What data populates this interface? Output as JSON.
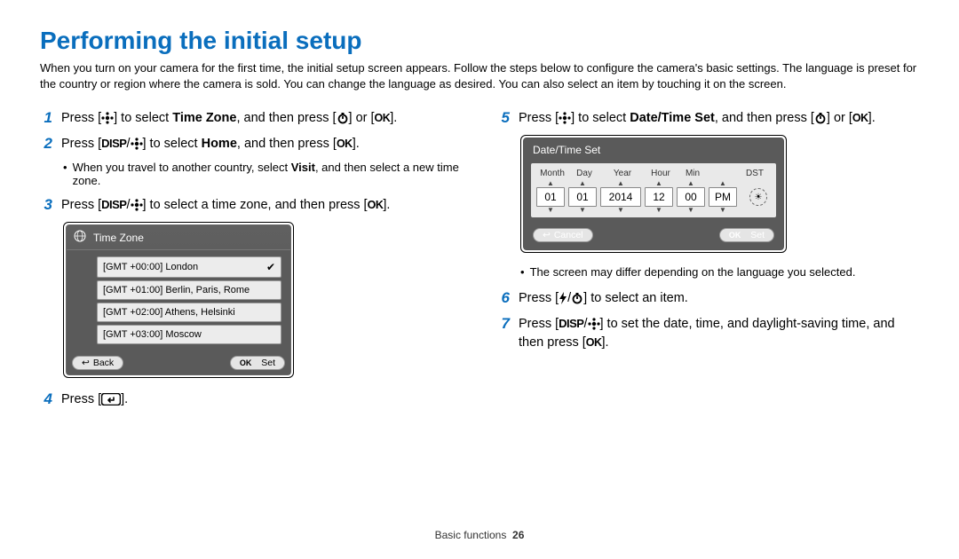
{
  "title": "Performing the initial setup",
  "intro": "When you turn on your camera for the first time, the initial setup screen appears. Follow the steps below to configure the camera's basic settings. The language is preset for the country or region where the camera is sold. You can change the language as desired. You can also select an item by touching it on the screen.",
  "steps": {
    "s1_a": "Press [",
    "s1_b": "] to select ",
    "s1_bold": "Time Zone",
    "s1_c": ", and then press [",
    "s1_d": "] or [",
    "s1_e": "].",
    "s2_a": "Press [",
    "s2_b": "] to select ",
    "s2_bold": "Home",
    "s2_c": ", and then press [",
    "s2_d": "].",
    "s2_sub": "When you travel to another country, select ",
    "s2_sub_b": "Visit",
    "s2_sub_c": ", and then select a new time zone.",
    "s3_a": "Press [",
    "s3_b": "] to select a time zone, and then press [",
    "s3_c": "].",
    "s4_a": "Press [",
    "s4_b": "].",
    "s5_a": "Press [",
    "s5_b": "] to select ",
    "s5_bold": "Date/Time Set",
    "s5_c": ", and then press [",
    "s5_d": "] or [",
    "s5_e": "].",
    "s5_sub": "The screen may differ depending on the language you selected.",
    "s6_a": "Press [",
    "s6_b": "] to select an item.",
    "s7_a": "Press [",
    "s7_b": "] to set the date, time, and daylight-saving time, and then press [",
    "s7_c": "]."
  },
  "tz": {
    "title": "Time Zone",
    "items": [
      "[GMT +00:00] London",
      "[GMT +01:00] Berlin, Paris, Rome",
      "[GMT +02:00] Athens, Helsinki",
      "[GMT +03:00] Moscow"
    ],
    "back": "Back",
    "set": "Set"
  },
  "dt": {
    "title": "Date/Time Set",
    "labels": {
      "month": "Month",
      "day": "Day",
      "year": "Year",
      "hour": "Hour",
      "min": "Min",
      "dst": "DST"
    },
    "vals": {
      "month": "01",
      "day": "01",
      "year": "2014",
      "hour": "12",
      "min": "00",
      "ampm": "PM"
    },
    "cancel": "Cancel",
    "set": "Set"
  },
  "glyph": {
    "disp": "DISP",
    "ok": "OK"
  },
  "footer": {
    "section": "Basic functions",
    "page": "26"
  }
}
